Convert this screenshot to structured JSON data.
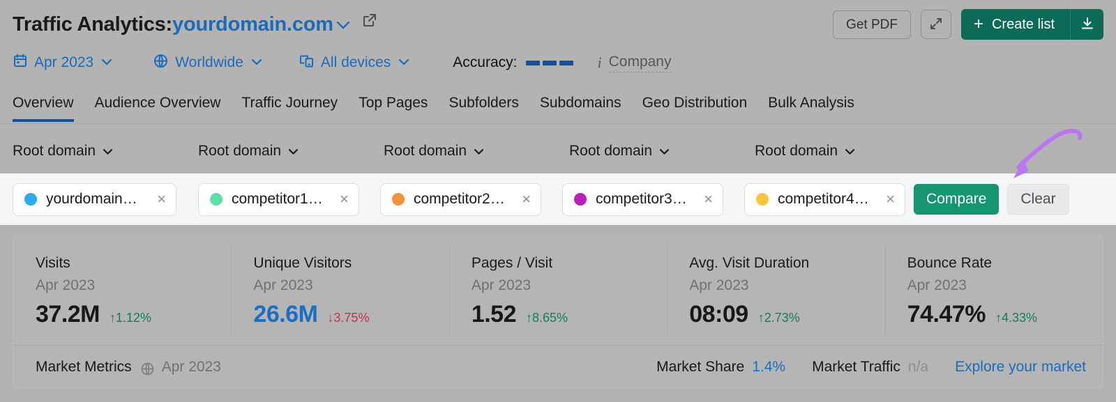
{
  "header": {
    "title_prefix": "Traffic Analytics:",
    "domain": "yourdomain.com",
    "domain_caret": "⌄",
    "external_link_icon": "external-link-icon",
    "get_pdf_label": "Get PDF",
    "expand_icon": "expand-icon",
    "create_list_label": "Create list",
    "create_list_plus": "+",
    "download_icon": "download-icon"
  },
  "filters": {
    "date": {
      "label": "Apr 2023",
      "icon": "calendar-icon",
      "caret": "⌄"
    },
    "location": {
      "label": "Worldwide",
      "icon": "globe-icon",
      "caret": "⌄"
    },
    "device": {
      "label": "All devices",
      "icon": "devices-icon",
      "caret": "⌄"
    },
    "accuracy_label": "Accuracy:",
    "accuracy_bars": 3,
    "accuracy_color": "#13529e",
    "info_icon": "info-icon",
    "company_label": "Company"
  },
  "tabs": [
    {
      "label": "Overview",
      "active": true
    },
    {
      "label": "Audience Overview",
      "active": false
    },
    {
      "label": "Traffic Journey",
      "active": false
    },
    {
      "label": "Top Pages",
      "active": false
    },
    {
      "label": "Subfolders",
      "active": false
    },
    {
      "label": "Subdomains",
      "active": false
    },
    {
      "label": "Geo Distribution",
      "active": false
    },
    {
      "label": "Bulk Analysis",
      "active": false
    }
  ],
  "root_selectors": [
    {
      "label": "Root domain",
      "caret": "⌄"
    },
    {
      "label": "Root domain",
      "caret": "⌄"
    },
    {
      "label": "Root domain",
      "caret": "⌄"
    },
    {
      "label": "Root domain",
      "caret": "⌄"
    },
    {
      "label": "Root domain",
      "caret": "⌄"
    }
  ],
  "chips": [
    {
      "label": "yourdomain…",
      "color": "#2aabf0",
      "close": "×"
    },
    {
      "label": "competitor1…",
      "color": "#5ce0a8",
      "close": "×"
    },
    {
      "label": "competitor2…",
      "color": "#f5903f",
      "close": "×"
    },
    {
      "label": "competitor3…",
      "color": "#b81fb8",
      "close": "×"
    },
    {
      "label": "competitor4…",
      "color": "#fbc63e",
      "close": "×"
    }
  ],
  "chip_actions": {
    "compare_label": "Compare",
    "compare_color": "#159570",
    "clear_label": "Clear"
  },
  "metrics": [
    {
      "title": "Visits",
      "date": "Apr 2023",
      "value": "37.2M",
      "change": "1.12%",
      "direction": "up",
      "arrow": "↑",
      "highlight": false
    },
    {
      "title": "Unique Visitors",
      "date": "Apr 2023",
      "value": "26.6M",
      "change": "3.75%",
      "direction": "down",
      "arrow": "↓",
      "highlight": true
    },
    {
      "title": "Pages / Visit",
      "date": "Apr 2023",
      "value": "1.52",
      "change": "8.65%",
      "direction": "up",
      "arrow": "↑",
      "highlight": false
    },
    {
      "title": "Avg. Visit Duration",
      "date": "Apr 2023",
      "value": "08:09",
      "change": "2.73%",
      "direction": "up",
      "arrow": "↑",
      "highlight": false
    },
    {
      "title": "Bounce Rate",
      "date": "Apr 2023",
      "value": "74.47%",
      "change": "4.33%",
      "direction": "up",
      "arrow": "↑",
      "highlight": false
    }
  ],
  "market": {
    "label": "Market Metrics",
    "globe_icon": "globe-icon",
    "date": "Apr 2023",
    "share_label": "Market Share",
    "share_value": "1.4%",
    "traffic_label": "Market Traffic",
    "traffic_value": "n/a",
    "explore_label": "Explore your market"
  },
  "annotation": {
    "arrow_color": "#b877f0",
    "points_to": "compare-button"
  }
}
